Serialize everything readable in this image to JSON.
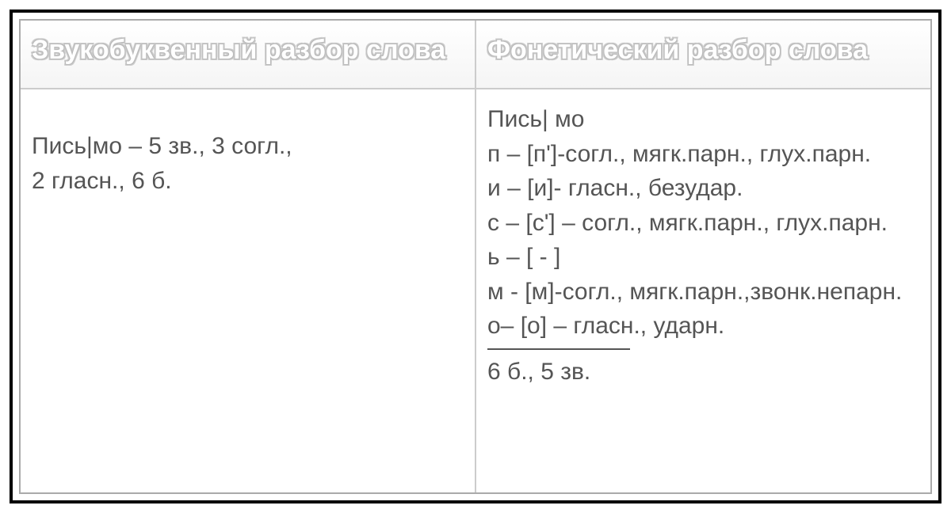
{
  "headers": {
    "left": "Звукобуквенный разбор слова",
    "right": "Фонетический разбор слова"
  },
  "leftCell": {
    "line1": "Пись|мо – 5 зв., 3 согл.,",
    "line2": "2   гласн., 6 б."
  },
  "rightCell": {
    "word": "Пись| мо",
    "lines": [
      "п – [п']-согл., мягк.парн., глух.парн.",
      "и – [и]- гласн., безудар.",
      "с – [с'] – согл., мягк.парн., глух.парн.",
      "ь – [ - ]",
      "м - [м]-согл., мягк.парн.,звонк.непарн.",
      "о– [о] – гласн., ударн."
    ],
    "summary": "6 б., 5 зв."
  }
}
